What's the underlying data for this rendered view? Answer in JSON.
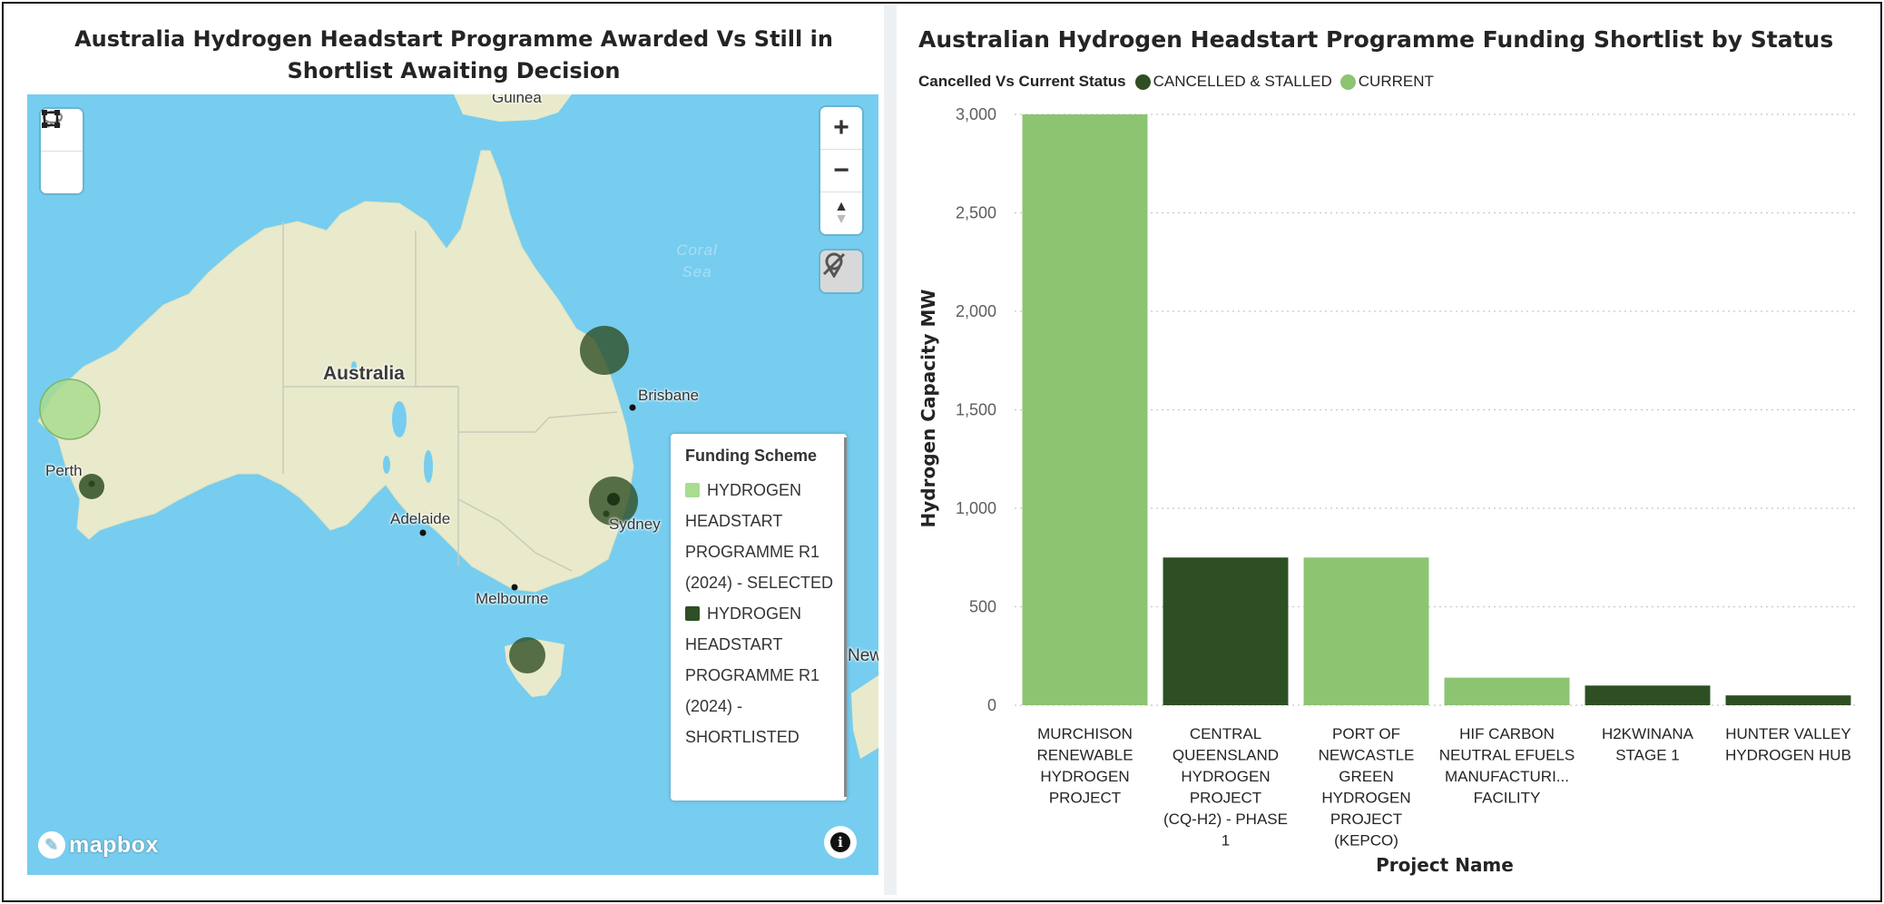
{
  "map_panel": {
    "title": "Australia Hydrogen Headstart Programme Awarded Vs Still in Shortlist Awaiting Decision",
    "labels": {
      "guinea": "Guinea",
      "coral_sea": "Coral Sea",
      "australia": "Australia",
      "brisbane": "Brisbane",
      "perth": "Perth",
      "adelaide": "Adelaide",
      "sydney": "Sydney",
      "melbourne": "Melbourne",
      "new_partial": "New"
    },
    "controls": {
      "zoom_in": "+",
      "zoom_out": "−",
      "compass": "▲"
    },
    "legend": {
      "title": "Funding Scheme",
      "entries": [
        {
          "label": "HYDROGEN HEADSTART PROGRAMME R1 (2024) - SELECTED",
          "color": "#a9dc8f"
        },
        {
          "label": "HYDROGEN HEADSTART PROGRAMME R1 (2024) - SHORTLISTED",
          "color": "#2f4f24"
        }
      ]
    },
    "attribution": "mapbox",
    "colors": {
      "ocean": "#76cdef",
      "land": "#e8eacb",
      "selected": "#a9dc8f",
      "shortlisted": "#2f4f24"
    }
  },
  "chart_panel": {
    "title": "Australian Hydrogen Headstart Programme Funding Shortlist by Status",
    "legend_title": "Cancelled Vs Current Status",
    "legend_items": [
      {
        "label": "CANCELLED & STALLED",
        "color": "#2e4f24"
      },
      {
        "label": "CURRENT",
        "color": "#8cc472"
      }
    ]
  },
  "chart_data": {
    "type": "bar",
    "title": "Australian Hydrogen Headstart Programme Funding Shortlist by Status",
    "xlabel": "Project Name",
    "ylabel": "Hydrogen Capacity MW",
    "ylim": [
      0,
      3000
    ],
    "yticks": [
      "0",
      "500",
      "1,000",
      "1,500",
      "2,000",
      "2,500",
      "3,000"
    ],
    "ytick_values": [
      0,
      500,
      1000,
      1500,
      2000,
      2500,
      3000
    ],
    "grid": true,
    "legend_placement": "top-left",
    "categories": [
      [
        "MURCHISON",
        "RENEWABLE",
        "HYDROGEN",
        "PROJECT"
      ],
      [
        "CENTRAL",
        "QUEENSLAND",
        "HYDROGEN",
        "PROJECT",
        "(CQ-H2) - PHASE",
        "1"
      ],
      [
        "PORT OF",
        "NEWCASTLE",
        "GREEN",
        "HYDROGEN",
        "PROJECT",
        "(KEPCO)"
      ],
      [
        "HIF CARBON",
        "NEUTRAL EFUELS",
        "MANUFACTURI...",
        "FACILITY"
      ],
      [
        "H2KWINANA",
        "STAGE 1"
      ],
      [
        "HUNTER VALLEY",
        "HYDROGEN HUB"
      ]
    ],
    "values": [
      3000,
      750,
      750,
      140,
      100,
      50
    ],
    "status": [
      "CURRENT",
      "CANCELLED & STALLED",
      "CURRENT",
      "CURRENT",
      "CANCELLED & STALLED",
      "CANCELLED & STALLED"
    ],
    "colors": {
      "CURRENT": "#8cc472",
      "CANCELLED & STALLED": "#2e4f24"
    }
  }
}
